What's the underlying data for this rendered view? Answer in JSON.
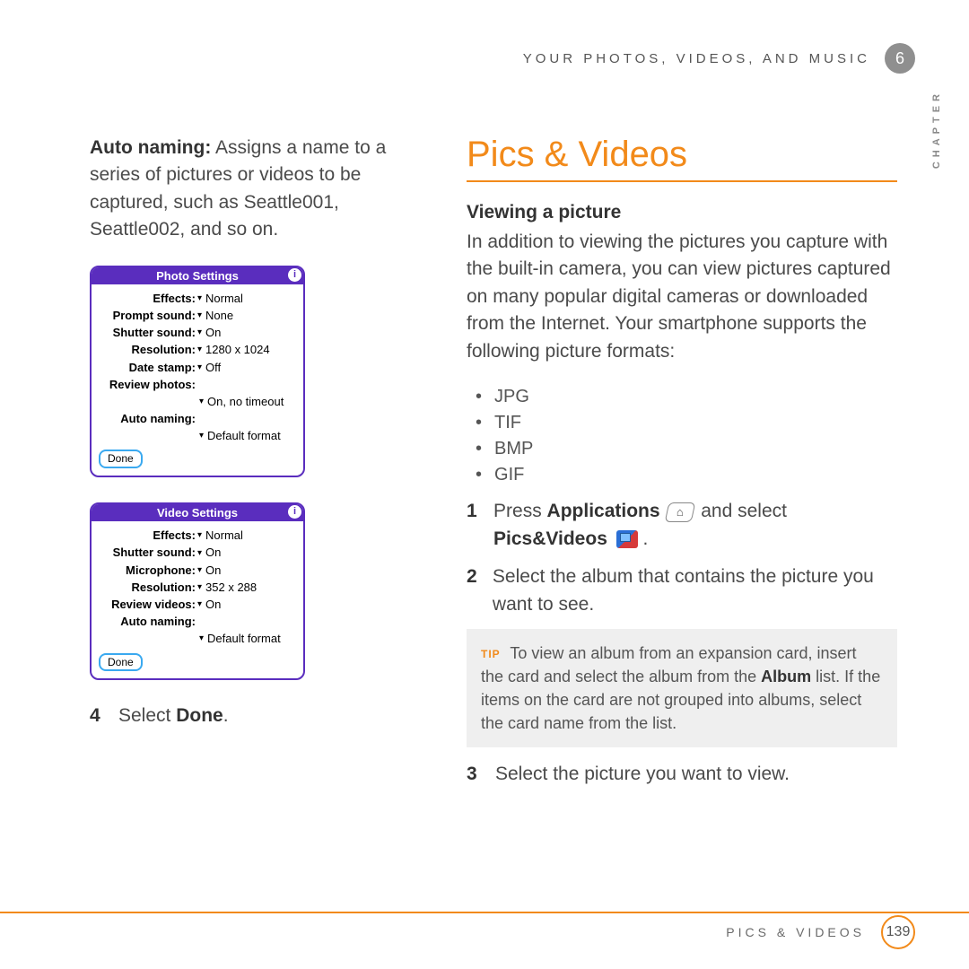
{
  "header": {
    "section": "YOUR PHOTOS, VIDEOS, AND MUSIC",
    "chapter_number": "6",
    "chapter_label": "CHAPTER"
  },
  "left": {
    "auto_naming_label": "Auto naming:",
    "auto_naming_text": " Assigns a name to a series of pictures or videos to be captured, such as Seattle001, Seattle002, and so on.",
    "photo_window": {
      "title": "Photo Settings",
      "rows": [
        {
          "label": "Effects:",
          "value": "Normal"
        },
        {
          "label": "Prompt sound:",
          "value": "None"
        },
        {
          "label": "Shutter sound:",
          "value": "On"
        },
        {
          "label": "Resolution:",
          "value": "1280 x 1024"
        },
        {
          "label": "Date stamp:",
          "value": "Off"
        },
        {
          "label": "Review photos:",
          "value": ""
        },
        {
          "label": "",
          "value": "On, no timeout",
          "sub": true
        },
        {
          "label": "Auto naming:",
          "value": ""
        },
        {
          "label": "",
          "value": "Default format",
          "sub": true
        }
      ],
      "done": "Done"
    },
    "video_window": {
      "title": "Video Settings",
      "rows": [
        {
          "label": "Effects:",
          "value": "Normal"
        },
        {
          "label": "Shutter sound:",
          "value": "On"
        },
        {
          "label": "Microphone:",
          "value": "On"
        },
        {
          "label": "Resolution:",
          "value": "352 x 288"
        },
        {
          "label": "Review videos:",
          "value": "On"
        },
        {
          "label": "Auto naming:",
          "value": ""
        },
        {
          "label": "",
          "value": "Default format",
          "sub": true
        }
      ],
      "done": "Done"
    },
    "step4_num": "4",
    "step4_text_a": "Select ",
    "step4_text_b": "Done",
    "step4_text_c": "."
  },
  "right": {
    "title": "Pics & Videos",
    "subheading": "Viewing a picture",
    "intro": "In addition to viewing the pictures you capture with the built-in camera, you can view pictures captured on many popular digital cameras or downloaded from the Internet. Your smartphone supports the following picture formats:",
    "formats": [
      "JPG",
      "TIF",
      "BMP",
      "GIF"
    ],
    "step1_num": "1",
    "step1_a": "Press ",
    "step1_b": "Applications",
    "step1_c": " and select ",
    "step1_d": "Pics&Videos",
    "step1_e": " .",
    "home_glyph": "⌂",
    "step2_num": "2",
    "step2": "Select the album that contains the picture you want to see.",
    "tip_label": "TIP",
    "tip_a": "To view an album from an expansion card, insert the card and select the album from the ",
    "tip_b": "Album",
    "tip_c": " list. If the items on the card are not grouped into albums, select the card name from the list.",
    "step3_num": "3",
    "step3": "Select the picture you want to view."
  },
  "footer": {
    "section": "PICS & VIDEOS",
    "page": "139"
  }
}
